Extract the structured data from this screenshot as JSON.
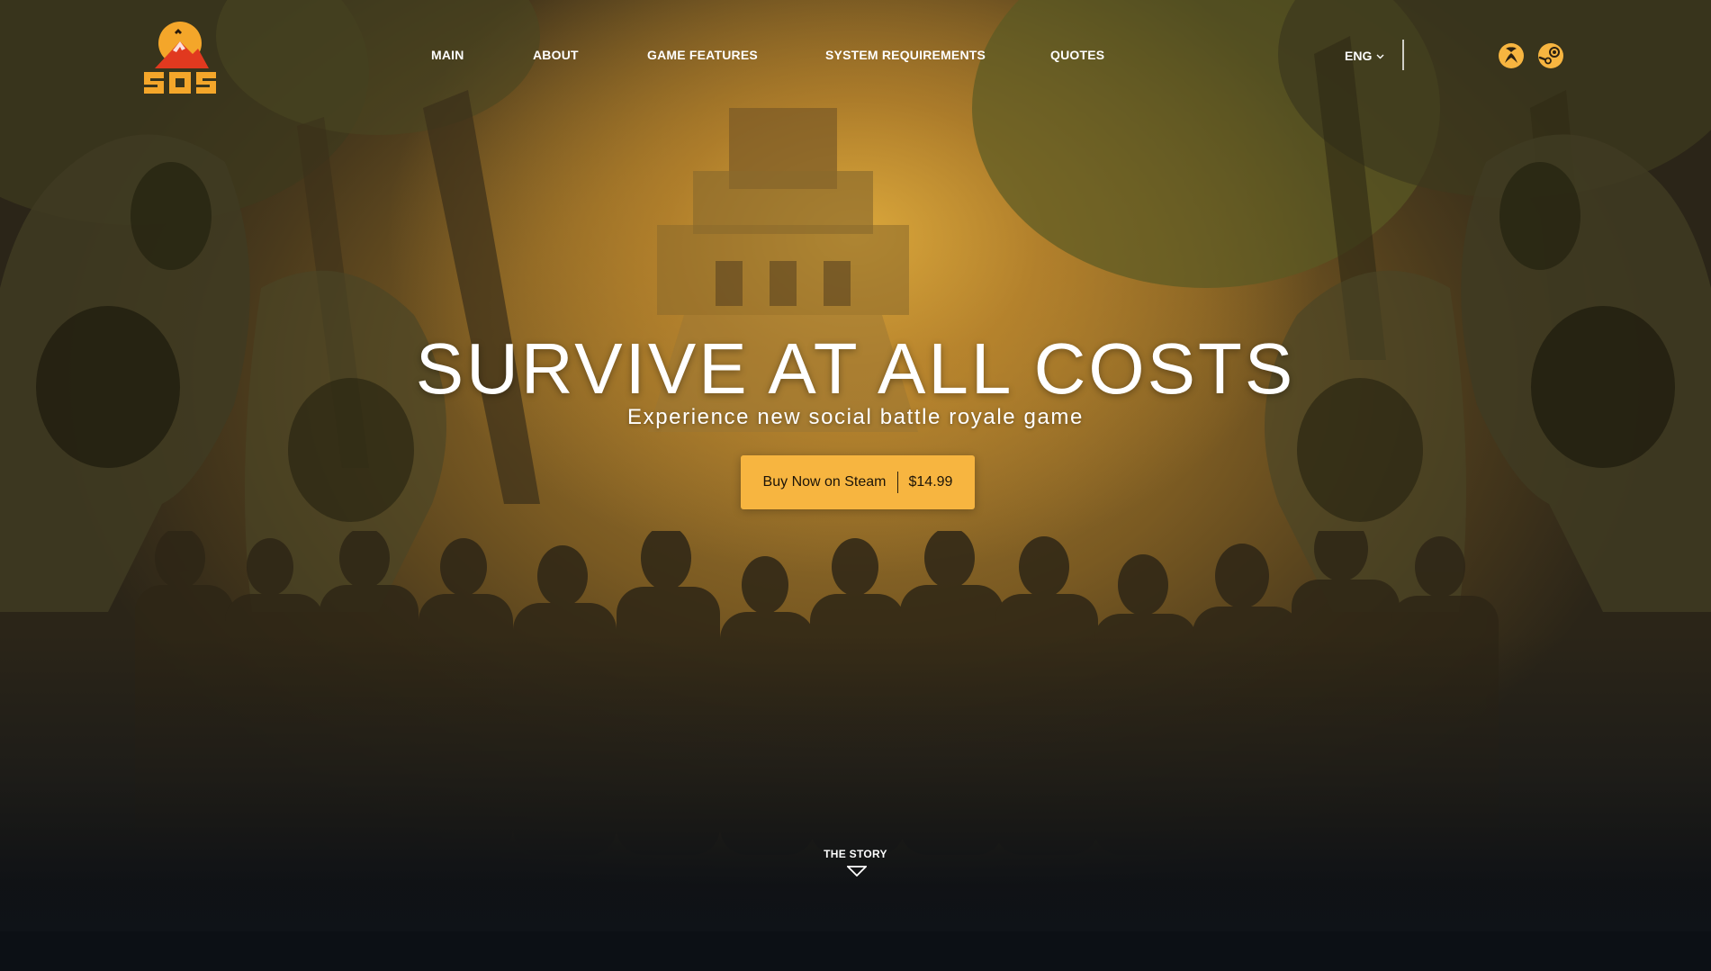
{
  "logo": {
    "text": "SOS"
  },
  "nav": {
    "items": [
      {
        "label": "MAIN"
      },
      {
        "label": "ABOUT"
      },
      {
        "label": "GAME FEATURES"
      },
      {
        "label": "SYSTEM REQUIREMENTS"
      },
      {
        "label": "QUOTES"
      }
    ]
  },
  "language": {
    "label": "ENG"
  },
  "platforms": [
    {
      "icon": "xbox-icon"
    },
    {
      "icon": "steam-icon"
    }
  ],
  "hero": {
    "headline": "SURVIVE AT ALL COSTS",
    "subline": "Experience new social battle royale game",
    "cta_label": "Buy Now on Steam",
    "price": "$14.99",
    "scroll_label": "THE STORY"
  },
  "colors": {
    "accent": "#f7b540",
    "logo_orange": "#f4a62a",
    "logo_red": "#e1391f",
    "page_bottom": "#0d1116"
  }
}
